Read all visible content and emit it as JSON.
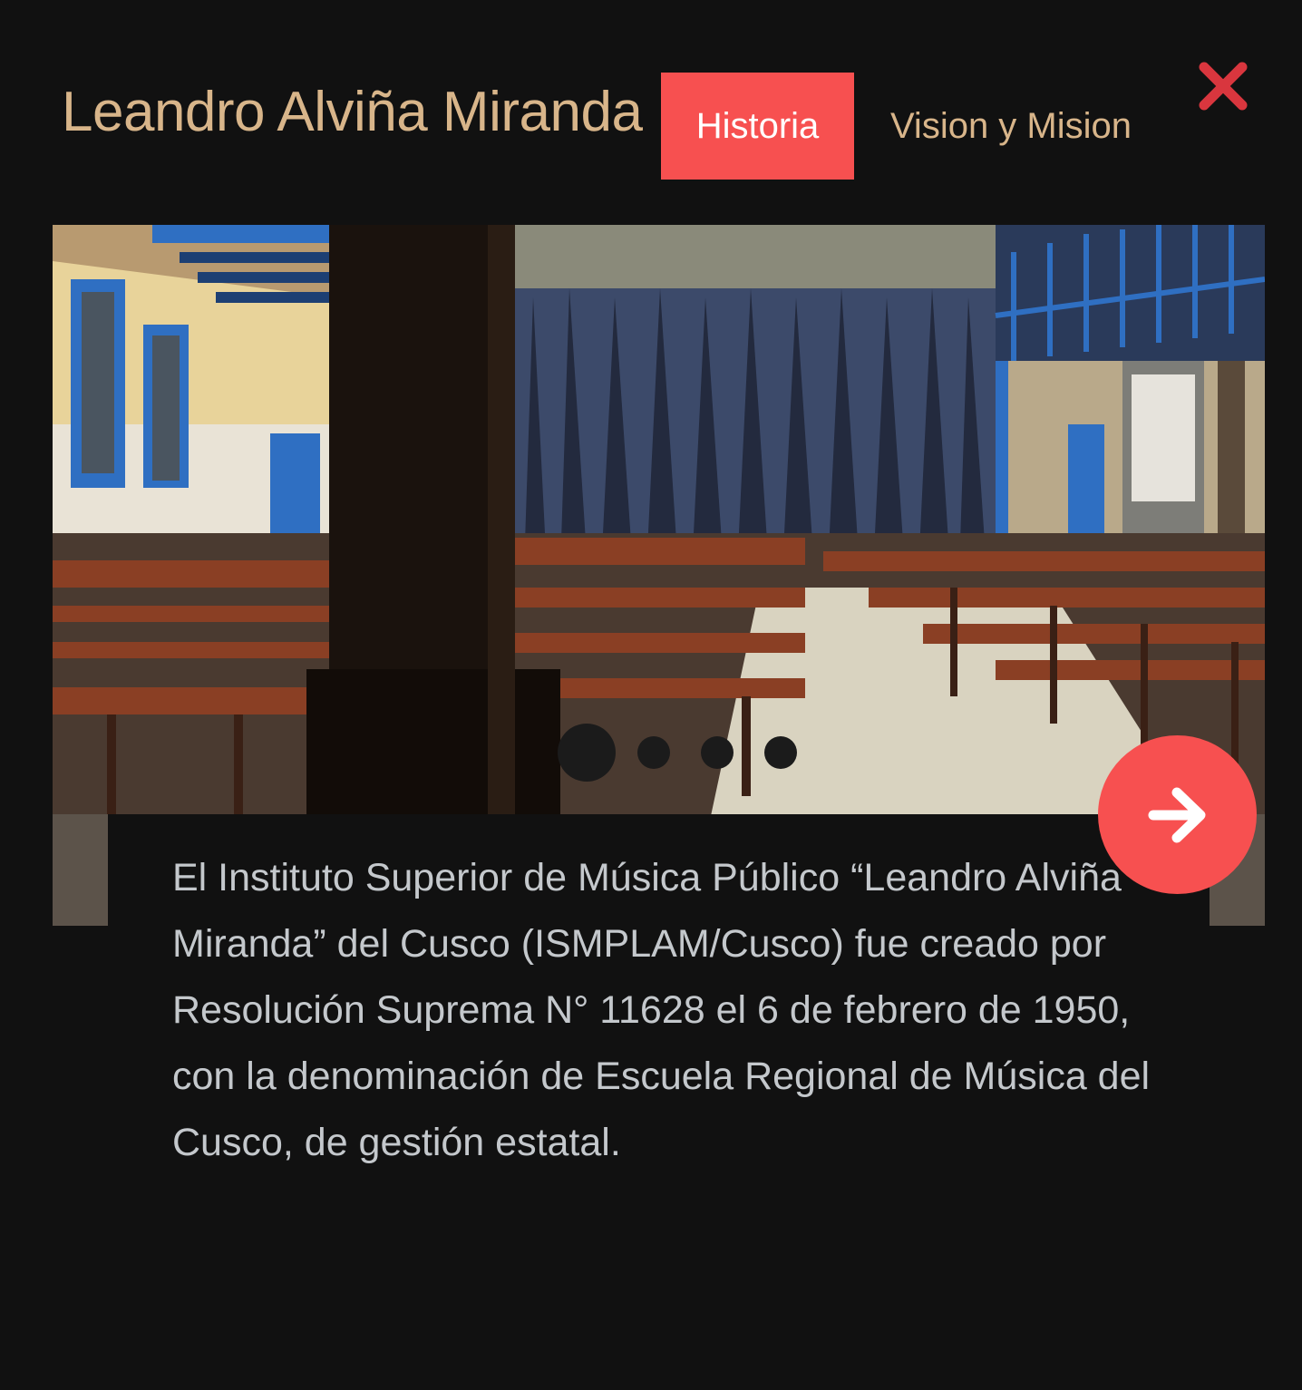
{
  "header": {
    "title": "Leandro Alviña Miranda",
    "tabs": [
      {
        "label": "Historia",
        "active": true
      },
      {
        "label": "Vision y Mision",
        "active": false
      }
    ],
    "close_icon": "close-x-icon"
  },
  "slider": {
    "image": "auditorium-with-wooden-benches-photo",
    "dots": [
      {
        "active": true
      },
      {
        "active": false
      },
      {
        "active": false
      },
      {
        "active": false
      }
    ],
    "next_icon": "arrow-right-icon"
  },
  "content": {
    "paragraph": "El Instituto Superior de Música Público “Leandro Alviña Miranda” del Cusco (ISMPLAM/Cusco) fue creado por Resolución Suprema N° 11628 el 6 de febrero de 1950, con la denominación de Escuela Regional de Música del Cusco, de gestión estatal."
  },
  "colors": {
    "background": "#111111",
    "accent": "#f75050",
    "title": "#d8b58a",
    "close": "#d9363e",
    "text": "#c4c8cc"
  }
}
